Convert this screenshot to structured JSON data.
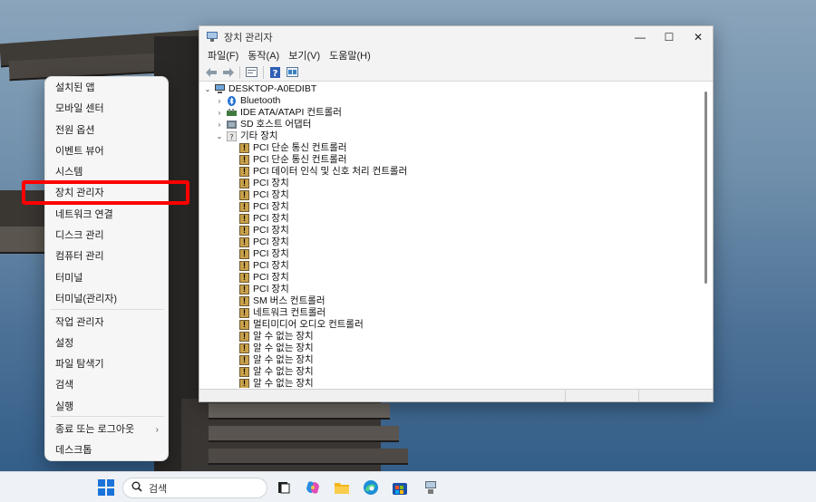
{
  "device_manager": {
    "title": "장치 관리자",
    "controls": {
      "minimize": "—",
      "maximize": "☐",
      "close": "✕"
    },
    "menu": [
      "파일(F)",
      "동작(A)",
      "보기(V)",
      "도움말(H)"
    ],
    "toolbar": [
      "back-arrow-icon",
      "forward-arrow-icon",
      "properties-icon",
      "help-icon",
      "view-icon"
    ],
    "tree": {
      "computer": "DESKTOP-A0EDIBT",
      "categories": [
        {
          "label": "Bluetooth",
          "expander": "›",
          "icon": "bluetooth-icon"
        },
        {
          "label": "IDE ATA/ATAPI 컨트롤러",
          "expander": "›",
          "icon": "ide-controller-icon"
        },
        {
          "label": "SD 호스트 어댑터",
          "expander": "›",
          "icon": "sd-host-icon"
        },
        {
          "label": "기타 장치",
          "expander": "⌄",
          "icon": "other-devices-icon"
        }
      ],
      "other_devices": [
        "PCI 단순 통신 컨트롤러",
        "PCI 단순 통신 컨트롤러",
        "PCI 데이터 인식 및 신호 처리 컨트롤러",
        "PCI 장치",
        "PCI 장치",
        "PCI 장치",
        "PCI 장치",
        "PCI 장치",
        "PCI 장치",
        "PCI 장치",
        "PCI 장치",
        "PCI 장치",
        "PCI 장치",
        "SM 버스 컨트롤러",
        "네트워크 컨트롤러",
        "멀티미디어 오디오 컨트롤러",
        "알 수 없는 장치",
        "알 수 없는 장치",
        "알 수 없는 장치",
        "알 수 없는 장치",
        "알 수 없는 장치",
        "알 수 없는 장치"
      ]
    }
  },
  "winx_menu": {
    "items": [
      "설치된 앱",
      "모바일 센터",
      "전원 옵션",
      "이벤트 뷰어",
      "시스템",
      "장치 관리자",
      "네트워크 연결",
      "디스크 관리",
      "컴퓨터 관리",
      "터미널",
      "터미널(관리자)",
      "작업 관리자",
      "설정",
      "파일 탐색기",
      "검색",
      "실행",
      "종료 또는 로그아웃",
      "데스크톱"
    ],
    "submenu_arrow": "›",
    "highlighted": "장치 관리자",
    "highlight_color": "#ff0000"
  },
  "taskbar": {
    "search_placeholder": "검색",
    "icons": [
      "windows-start-icon",
      "task-view-icon",
      "copilot-icon",
      "file-explorer-icon",
      "edge-icon",
      "store-icon",
      "device-manager-icon"
    ]
  }
}
